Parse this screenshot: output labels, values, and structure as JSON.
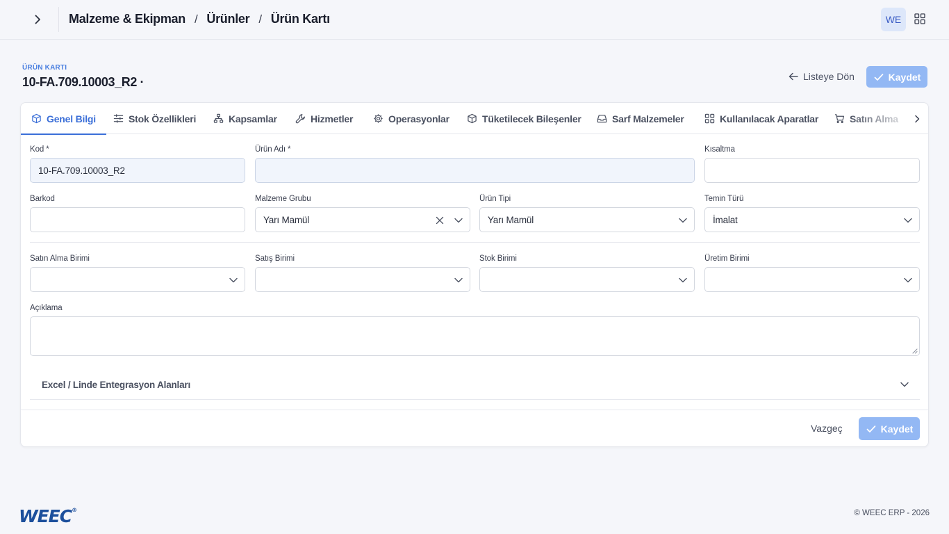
{
  "breadcrumb": {
    "items": [
      "Malzeme & Ekipman",
      "Ürünler",
      "Ürün Kartı"
    ],
    "separator": "/"
  },
  "user": {
    "initials": "WE"
  },
  "page": {
    "label": "ÜRÜN KARTI",
    "title": "10-FA.709.10003_R2 ·",
    "back_label": "Listeye Dön",
    "save_label": "Kaydet"
  },
  "tabs": [
    {
      "label": "Genel Bilgi",
      "icon": "cube-icon",
      "active": true
    },
    {
      "label": "Stok Özellikleri",
      "icon": "sliders-icon"
    },
    {
      "label": "Kapsamlar",
      "icon": "hierarchy-icon"
    },
    {
      "label": "Hizmetler",
      "icon": "wrench-icon"
    },
    {
      "label": "Operasyonlar",
      "icon": "gear-icon"
    },
    {
      "label": "Tüketilecek Bileşenler",
      "icon": "cube-icon"
    },
    {
      "label": "Sarf Malzemeler",
      "icon": "inbox-icon"
    },
    {
      "label": "Kullanılacak Aparatlar",
      "icon": "grid-icon"
    },
    {
      "label": "Satın Alma",
      "icon": "cart-icon"
    }
  ],
  "form": {
    "kod": {
      "label": "Kod *",
      "value": "10-FA.709.10003_R2"
    },
    "urun_adi": {
      "label": "Ürün Adı *",
      "value": ""
    },
    "kisaltma": {
      "label": "Kısaltma",
      "value": ""
    },
    "barkod": {
      "label": "Barkod",
      "value": ""
    },
    "malzeme_grubu": {
      "label": "Malzeme Grubu",
      "value": "Yarı Mamül"
    },
    "urun_tipi": {
      "label": "Ürün Tipi",
      "value": "Yarı Mamül"
    },
    "temin_turu": {
      "label": "Temin Türü",
      "value": "İmalat"
    },
    "satin_alma_birimi": {
      "label": "Satın Alma Birimi",
      "value": ""
    },
    "satis_birimi": {
      "label": "Satış Birimi",
      "value": ""
    },
    "stok_birimi": {
      "label": "Stok Birimi",
      "value": ""
    },
    "uretim_birimi": {
      "label": "Üretim Birimi",
      "value": ""
    },
    "aciklama": {
      "label": "Açıklama",
      "value": ""
    }
  },
  "accordion": {
    "title": "Excel / Linde Entegrasyon Alanları"
  },
  "footer": {
    "cancel_label": "Vazgeç",
    "save_label": "Kaydet"
  },
  "brand": {
    "logo": "WEEC",
    "trademark": "®",
    "copyright": "© WEEC ERP - 2026"
  },
  "colors": {
    "accent": "#3b6fd8",
    "save_button": "#93b8f4",
    "logo": "#1c4f9c"
  }
}
